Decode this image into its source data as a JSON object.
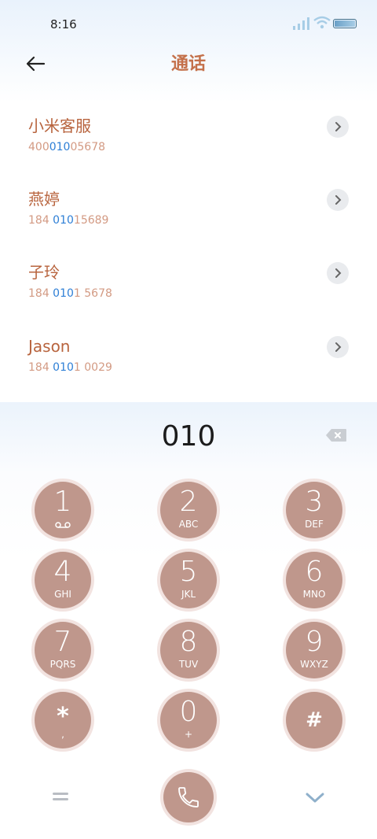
{
  "status_bar": {
    "time": "8:16"
  },
  "header": {
    "title": "通话"
  },
  "contacts": [
    {
      "name": "小米客服",
      "num_pre": "400",
      "num_match": "010",
      "num_post": "05678"
    },
    {
      "name": "燕婷",
      "num_pre": "184 ",
      "num_match": "010",
      "num_post": "15689"
    },
    {
      "name": "子玲",
      "num_pre": "184 ",
      "num_match": "010",
      "num_post": "1 5678"
    },
    {
      "name": "Jason",
      "num_pre": "184 ",
      "num_match": "010",
      "num_post": "1 0029"
    }
  ],
  "dialer": {
    "input": "010",
    "keys": [
      {
        "digit": "1",
        "letters": ""
      },
      {
        "digit": "2",
        "letters": "ABC"
      },
      {
        "digit": "3",
        "letters": "DEF"
      },
      {
        "digit": "4",
        "letters": "GHI"
      },
      {
        "digit": "5",
        "letters": "JKL"
      },
      {
        "digit": "6",
        "letters": "MNO"
      },
      {
        "digit": "7",
        "letters": "PQRS"
      },
      {
        "digit": "8",
        "letters": "TUV"
      },
      {
        "digit": "9",
        "letters": "WXYZ"
      },
      {
        "digit": "*",
        "letters": ","
      },
      {
        "digit": "0",
        "letters": "+"
      },
      {
        "digit": "#",
        "letters": ""
      }
    ]
  },
  "colors": {
    "accent": "#c4704a",
    "key": "#bf978c",
    "highlight": "#2e7fd6"
  }
}
